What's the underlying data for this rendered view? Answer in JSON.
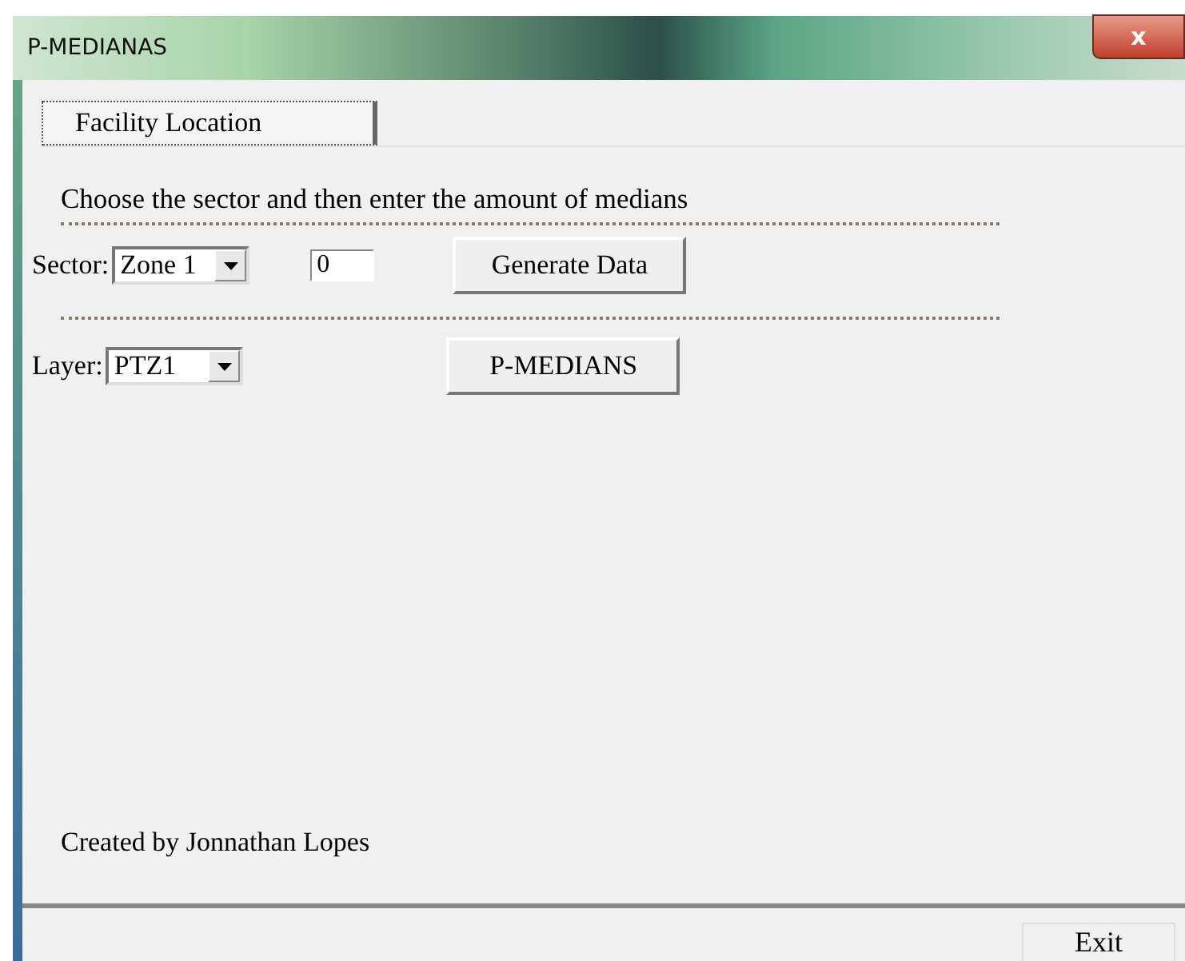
{
  "window": {
    "title": "P-MEDIANAS",
    "close": "x"
  },
  "tabs": [
    {
      "label": "Facility Location",
      "selected": true
    }
  ],
  "instruction": "Choose the sector and then enter the amount of medians",
  "rows": [
    {
      "label": "Sector:",
      "dropdown": "Zone 1",
      "field": "0",
      "button": "Generate Data"
    },
    {
      "label": "Layer:",
      "dropdown": "PTZ1",
      "button": "P-MEDIANS"
    }
  ],
  "credit": "Created by Jonnathan Lopes",
  "footer_button": "Exit"
}
